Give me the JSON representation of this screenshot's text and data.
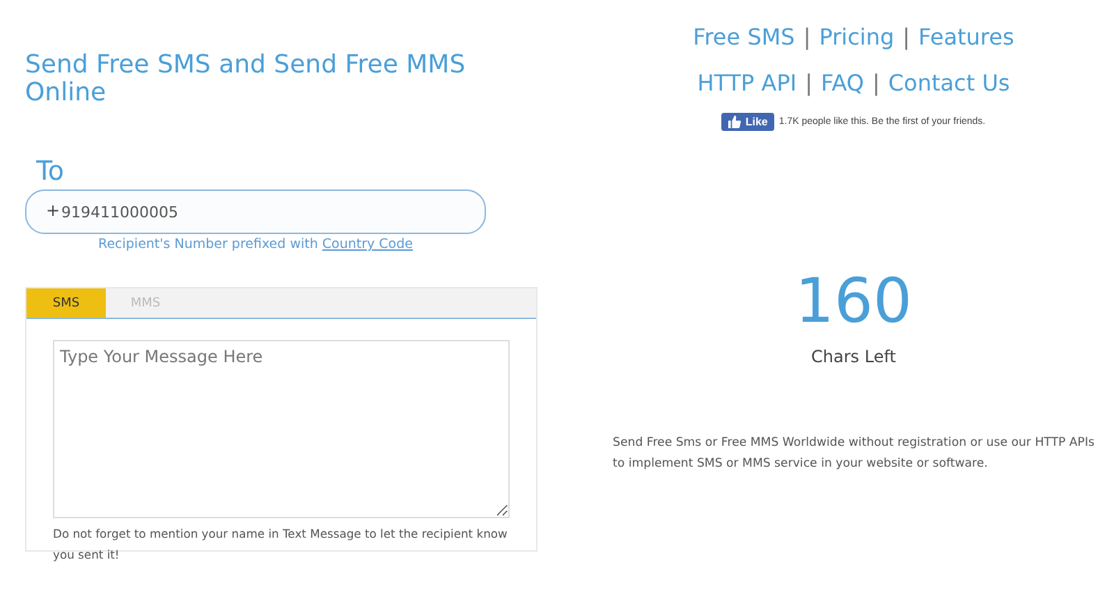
{
  "heading": "Send Free SMS and Send Free MMS Online",
  "to": {
    "label": "To",
    "prefix": "+",
    "value": "919411000005",
    "hint": "Recipient's Number prefixed with ",
    "hint_link": "Country Code"
  },
  "tabs": [
    {
      "label": "SMS",
      "selected": true
    },
    {
      "label": "MMS",
      "selected": false
    }
  ],
  "message": {
    "placeholder": "Type Your Message Here",
    "note": "Do not forget to mention your name in Text Message to let the recipient know you sent it!"
  },
  "nav_rows": [
    [
      {
        "kind": "link",
        "text": "Free SMS"
      },
      {
        "kind": "separator",
        "text": "|"
      },
      {
        "kind": "link",
        "text": "Pricing"
      },
      {
        "kind": "separator",
        "text": "|"
      },
      {
        "kind": "link",
        "text": "Features"
      }
    ],
    [
      {
        "kind": "link",
        "text": "HTTP API"
      },
      {
        "kind": "separator",
        "text": "|"
      },
      {
        "kind": "link",
        "text": "FAQ"
      },
      {
        "kind": "separator",
        "text": "|"
      },
      {
        "kind": "link",
        "text": "Contact Us"
      }
    ]
  ],
  "like": {
    "button": "Like",
    "text": "1.7K people like this. Be the first of your friends."
  },
  "counter": {
    "value": "160",
    "label": "Chars Left"
  },
  "description": "Send Free Sms or Free MMS Worldwide without registration or use our HTTP APIs to implement SMS or MMS service in your website or software."
}
